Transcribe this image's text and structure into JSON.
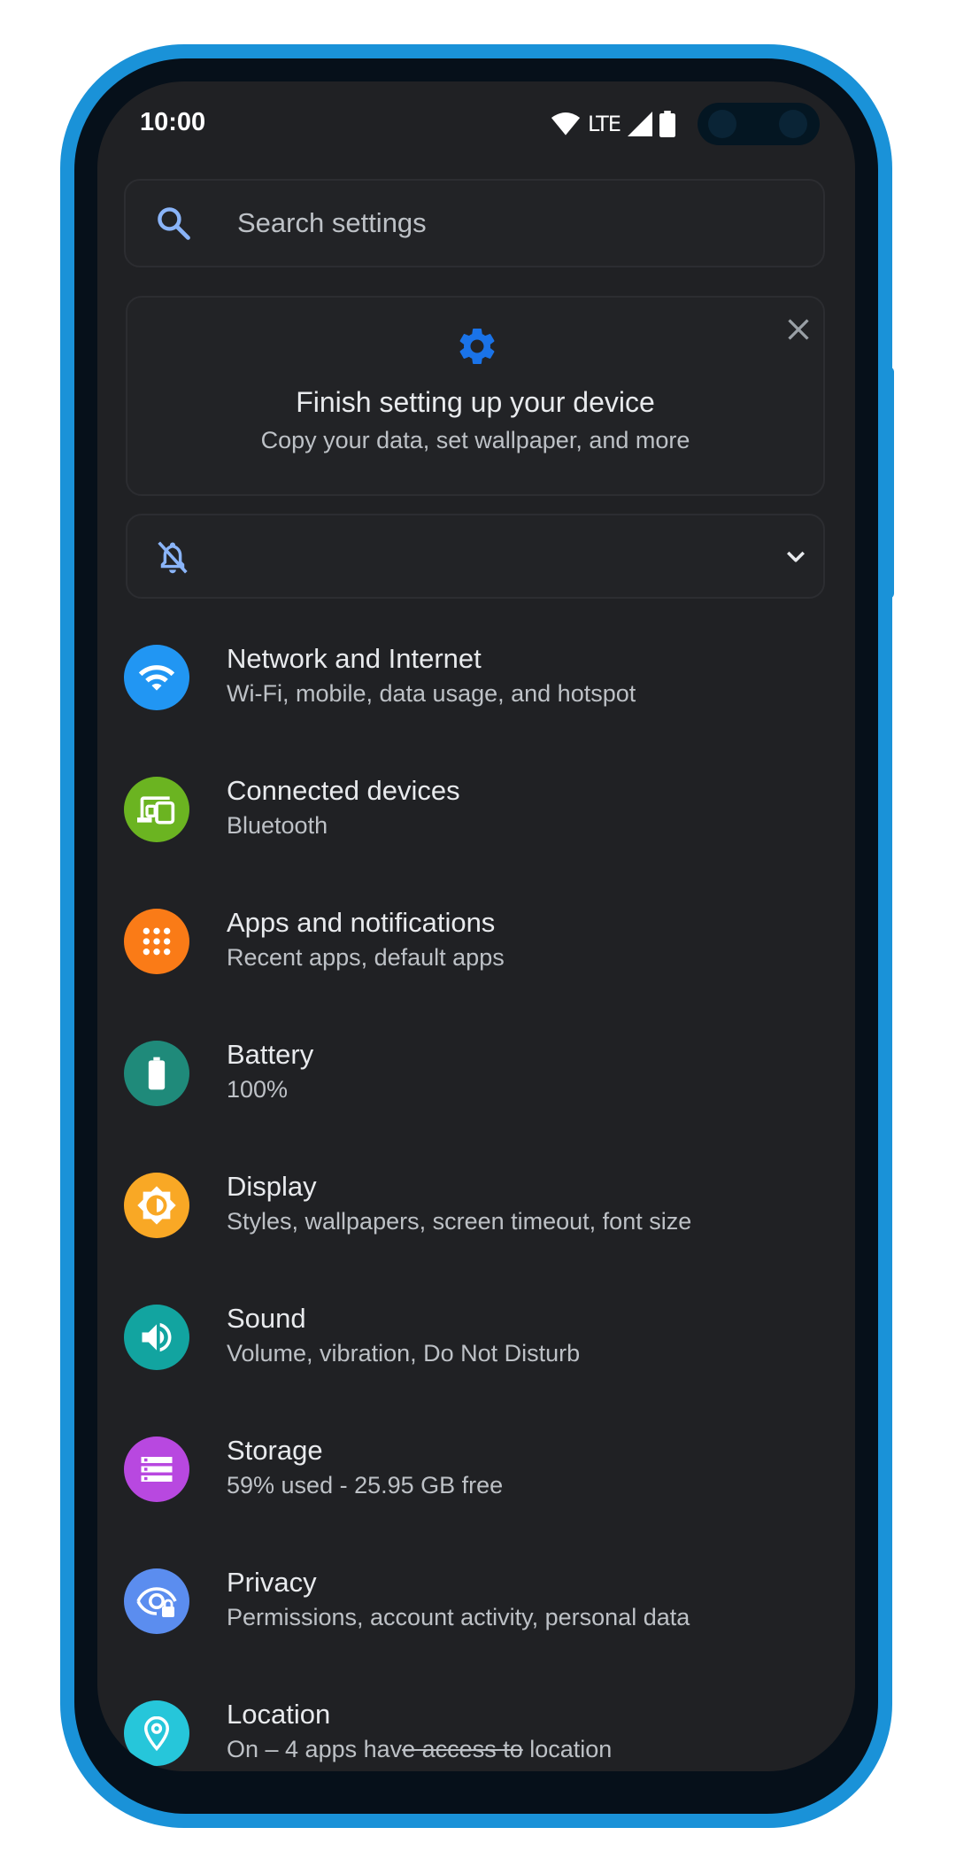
{
  "status_bar": {
    "time": "10:00",
    "network_label": "LTE"
  },
  "search": {
    "placeholder": "Search settings"
  },
  "setup_card": {
    "title": "Finish setting up your device",
    "subtitle": "Copy your data, set wallpaper, and more"
  },
  "settings": [
    {
      "title": "Network and Internet",
      "subtitle": "Wi-Fi, mobile, data usage, and hotspot",
      "icon": "wifi-icon",
      "color": "#2196f3"
    },
    {
      "title": "Connected devices",
      "subtitle": "Bluetooth",
      "icon": "devices-icon",
      "color": "#6bb421"
    },
    {
      "title": "Apps and notifications",
      "subtitle": "Recent apps, default apps",
      "icon": "apps-grid-icon",
      "color": "#fa7b17"
    },
    {
      "title": "Battery",
      "subtitle": "100%",
      "icon": "battery-icon",
      "color": "#1f8a7a"
    },
    {
      "title": "Display",
      "subtitle": "Styles, wallpapers, screen timeout, font size",
      "icon": "brightness-icon",
      "color": "#f9a825"
    },
    {
      "title": "Sound",
      "subtitle": "Volume, vibration, Do Not Disturb",
      "icon": "volume-icon",
      "color": "#12a4a0"
    },
    {
      "title": "Storage",
      "subtitle": "59% used - 25.95 GB free",
      "icon": "storage-icon",
      "color": "#b848e0"
    },
    {
      "title": "Privacy",
      "subtitle": "Permissions, account activity, personal data",
      "icon": "privacy-eye-icon",
      "color": "#5b8def"
    },
    {
      "title": "Location",
      "subtitle_parts": [
        "On – 4 apps hav",
        "e access to",
        " location"
      ],
      "icon": "location-pin-icon",
      "color": "#26c6da"
    }
  ],
  "colors": {
    "frame": "#1a92d8",
    "screen_bg": "#202124",
    "accent_blue": "#4285f4"
  }
}
